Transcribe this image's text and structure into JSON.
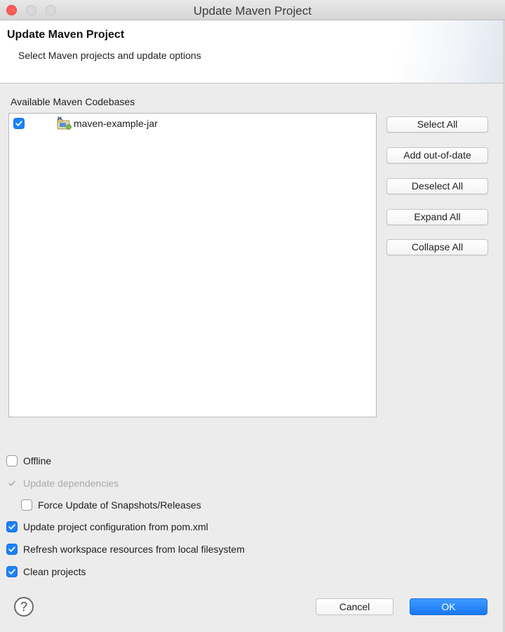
{
  "window": {
    "title": "Update Maven Project"
  },
  "header": {
    "title": "Update Maven Project",
    "subtitle": "Select Maven projects and update options"
  },
  "codebases": {
    "label": "Available Maven Codebases",
    "items": [
      {
        "label": "maven-example-jar",
        "checked": true,
        "icon": "maven-project-icon"
      }
    ]
  },
  "side_buttons": {
    "select_all": "Select All",
    "add_out_of_date": "Add out-of-date",
    "deselect_all": "Deselect All",
    "expand_all": "Expand All",
    "collapse_all": "Collapse All"
  },
  "options": {
    "offline": {
      "label": "Offline",
      "checked": false
    },
    "update_dependencies": {
      "label": "Update dependencies",
      "checked": true,
      "disabled": true
    },
    "force_update": {
      "label": "Force Update of Snapshots/Releases",
      "checked": false
    },
    "update_config": {
      "label": "Update project configuration from pom.xml",
      "checked": true
    },
    "refresh_workspace": {
      "label": "Refresh workspace resources from local filesystem",
      "checked": true
    },
    "clean_projects": {
      "label": "Clean projects",
      "checked": true
    }
  },
  "footer": {
    "help_symbol": "?",
    "cancel": "Cancel",
    "ok": "OK"
  },
  "colors": {
    "accent": "#1a82fb",
    "close": "#fc5f57"
  }
}
